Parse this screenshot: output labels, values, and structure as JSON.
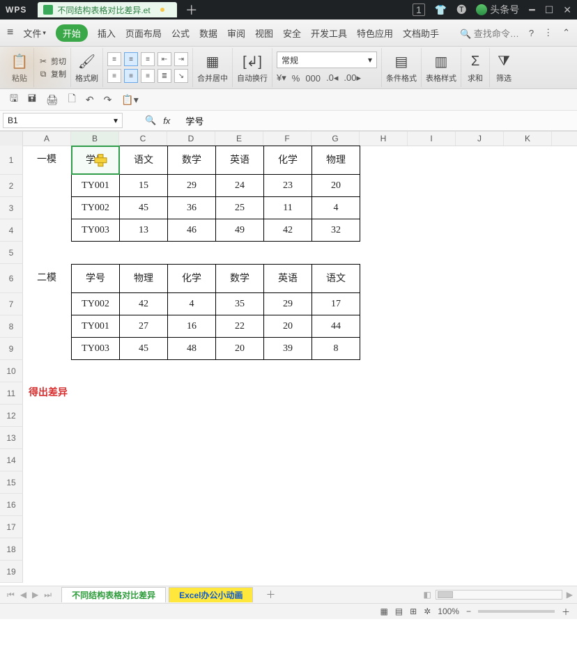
{
  "window": {
    "brand": "WPS",
    "doc_tab": "不同结构表格对比差异.et",
    "box_num": "1",
    "account": "头条号"
  },
  "menu": {
    "file": "文件",
    "start": "开始",
    "items": [
      "插入",
      "页面布局",
      "公式",
      "数据",
      "审阅",
      "视图",
      "安全",
      "开发工具",
      "特色应用",
      "文档助手"
    ],
    "search": "查找命令…"
  },
  "ribbon": {
    "paste": "粘贴",
    "cut": "剪切",
    "copy": "复制",
    "fmtpaint": "格式刷",
    "merge": "合并居中",
    "wrap": "自动换行",
    "numfmt_sel": "常规",
    "condfmt": "条件格式",
    "tablestyle": "表格样式",
    "sum": "求和",
    "filter": "筛选"
  },
  "namebox": "B1",
  "formula": "学号",
  "columns": [
    "A",
    "B",
    "C",
    "D",
    "E",
    "F",
    "G",
    "H",
    "I",
    "J",
    "K"
  ],
  "row_labels": [
    "1",
    "2",
    "3",
    "4",
    "5",
    "6",
    "7",
    "8",
    "9",
    "10",
    "11",
    "12",
    "13",
    "14",
    "15",
    "16",
    "17",
    "18",
    "19"
  ],
  "t1": {
    "title": "一模",
    "headers": [
      "学号",
      "语文",
      "数学",
      "英语",
      "化学",
      "物理"
    ],
    "rows": [
      [
        "TY001",
        "15",
        "29",
        "24",
        "23",
        "20"
      ],
      [
        "TY002",
        "45",
        "36",
        "25",
        "11",
        "4"
      ],
      [
        "TY003",
        "13",
        "46",
        "49",
        "42",
        "32"
      ]
    ]
  },
  "t2": {
    "title": "二模",
    "headers": [
      "学号",
      "物理",
      "化学",
      "数学",
      "英语",
      "语文"
    ],
    "rows": [
      [
        "TY002",
        "42",
        "4",
        "35",
        "29",
        "17"
      ],
      [
        "TY001",
        "27",
        "16",
        "22",
        "20",
        "44"
      ],
      [
        "TY003",
        "45",
        "48",
        "20",
        "39",
        "8"
      ]
    ]
  },
  "red_note": "得出差异",
  "sheets": {
    "s1": "不同结构表格对比差异",
    "s2": "Excel办公小动画"
  },
  "status": {
    "zoom": "100%"
  },
  "chart_data": {
    "type": "table",
    "tables": [
      {
        "title": "一模",
        "columns": [
          "学号",
          "语文",
          "数学",
          "英语",
          "化学",
          "物理"
        ],
        "rows": [
          [
            "TY001",
            15,
            29,
            24,
            23,
            20
          ],
          [
            "TY002",
            45,
            36,
            25,
            11,
            4
          ],
          [
            "TY003",
            13,
            46,
            49,
            42,
            32
          ]
        ]
      },
      {
        "title": "二模",
        "columns": [
          "学号",
          "物理",
          "化学",
          "数学",
          "英语",
          "语文"
        ],
        "rows": [
          [
            "TY002",
            42,
            4,
            35,
            29,
            17
          ],
          [
            "TY001",
            27,
            16,
            22,
            20,
            44
          ],
          [
            "TY003",
            45,
            48,
            20,
            39,
            8
          ]
        ]
      }
    ]
  }
}
